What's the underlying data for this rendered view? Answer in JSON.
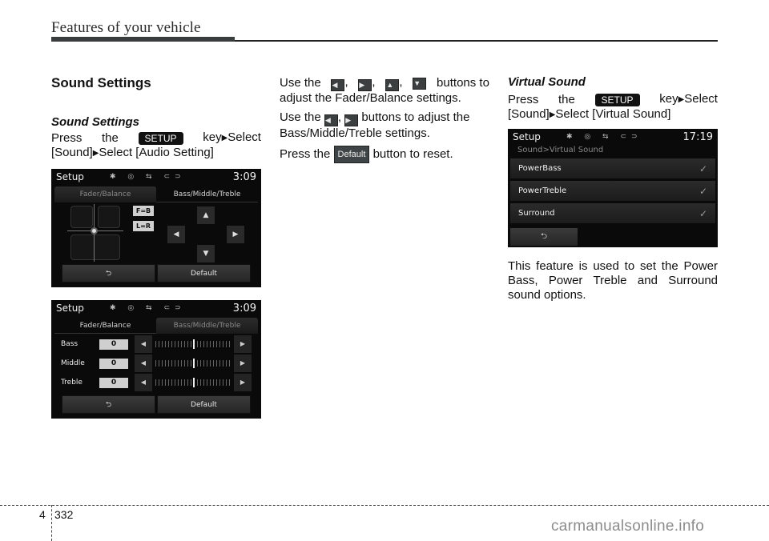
{
  "header": {
    "title": "Features of your vehicle"
  },
  "col1": {
    "section_title": "Sound Settings",
    "subsection_title": "Sound Settings",
    "line1": {
      "press": "Press",
      "the": "the",
      "key": "SETUP",
      "after": "key",
      "select": "Select"
    },
    "line2": {
      "a": "[Sound]",
      "b": "Select [Audio Setting]"
    }
  },
  "col2": {
    "p1": {
      "use": "Use the",
      "after": "buttons to",
      "line2": "adjust the Fader/Balance settings."
    },
    "p2": {
      "use": "Use the",
      "after": "buttons to adjust the",
      "line2": "Bass/Middle/Treble settings."
    },
    "p3": {
      "press": "Press the",
      "key": "Default",
      "after": "button to reset."
    },
    "icons": {
      "left": "◀",
      "right": "▶",
      "up": "▲",
      "down": "▼"
    }
  },
  "col3": {
    "subsection_title": "Virtual Sound",
    "line1": {
      "press": "Press",
      "the": "the",
      "key": "SETUP",
      "after": "key",
      "select": "Select"
    },
    "line2": {
      "a": "[Sound]",
      "b": "Select [Virtual Sound]"
    },
    "description": "This feature is used to set the Power Bass, Power Treble and Surround sound options."
  },
  "screen_fader": {
    "title": "Setup",
    "clock": "3:09",
    "status_icons": "✱ ◎ ⇆ ⊂⊃",
    "tabs": [
      "Fader/Balance",
      "Bass/Middle/Treble"
    ],
    "fb_button": "F=B",
    "lr_button": "L=R",
    "back_label": "⮌",
    "default_label": "Default"
  },
  "screen_bmt": {
    "title": "Setup",
    "clock": "3:09",
    "status_icons": "✱ ◎ ⇆ ⊂⊃",
    "tabs": [
      "Fader/Balance",
      "Bass/Middle/Treble"
    ],
    "rows": [
      {
        "label": "Bass",
        "value": "0"
      },
      {
        "label": "Middle",
        "value": "0"
      },
      {
        "label": "Treble",
        "value": "0"
      }
    ],
    "back_label": "⮌",
    "default_label": "Default"
  },
  "screen_virtual": {
    "title": "Setup",
    "clock": "17:19",
    "status_icons": "✱ ◎ ⇆ ⊂⊃",
    "path": "Sound>Virtual Sound",
    "rows": [
      {
        "label": "PowerBass",
        "checked": "✓"
      },
      {
        "label": "PowerTreble",
        "checked": "✓"
      },
      {
        "label": "Surround",
        "checked": "✓"
      }
    ],
    "back_label": "⮌"
  },
  "footer": {
    "chapter": "4",
    "page": "332",
    "watermark": "carmanualsonline.info"
  }
}
